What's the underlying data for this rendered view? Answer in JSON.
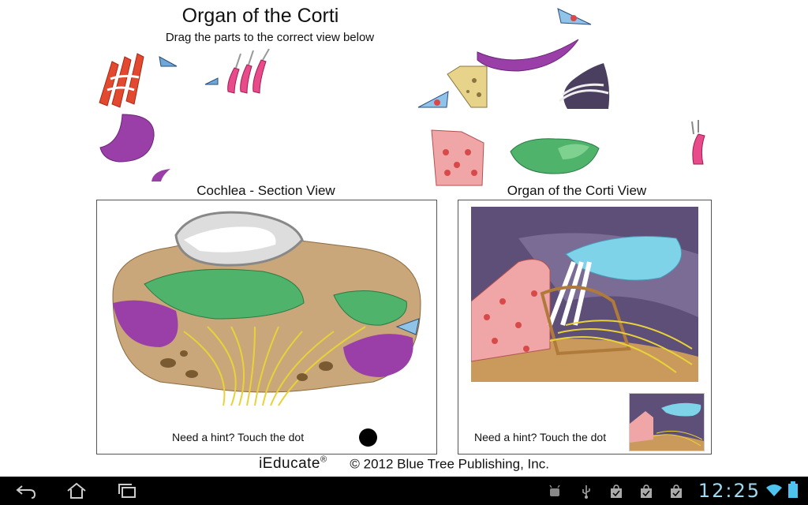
{
  "header": {
    "title": "Organ of the Corti",
    "subtitle": "Drag the parts to the correct view below"
  },
  "panels": {
    "left": {
      "title": "Cochlea - Section View",
      "hint": "Need a hint? Touch the dot"
    },
    "right": {
      "title": "Organ of the Corti View",
      "hint": "Need a hint? Touch the dot"
    }
  },
  "footer": {
    "brand": "iEducate",
    "registered": "®",
    "copyright": "© 2012 Blue Tree Publishing, Inc."
  },
  "statusbar": {
    "time": "12:25"
  },
  "colors": {
    "purple": "#8e3a9c",
    "green": "#4fb36c",
    "pink": "#ef8f8f",
    "nerve": "#e8d23a",
    "bone": "#c9a77a",
    "tectorial": "#7fd3e8",
    "clock": "#9fd9ef"
  }
}
